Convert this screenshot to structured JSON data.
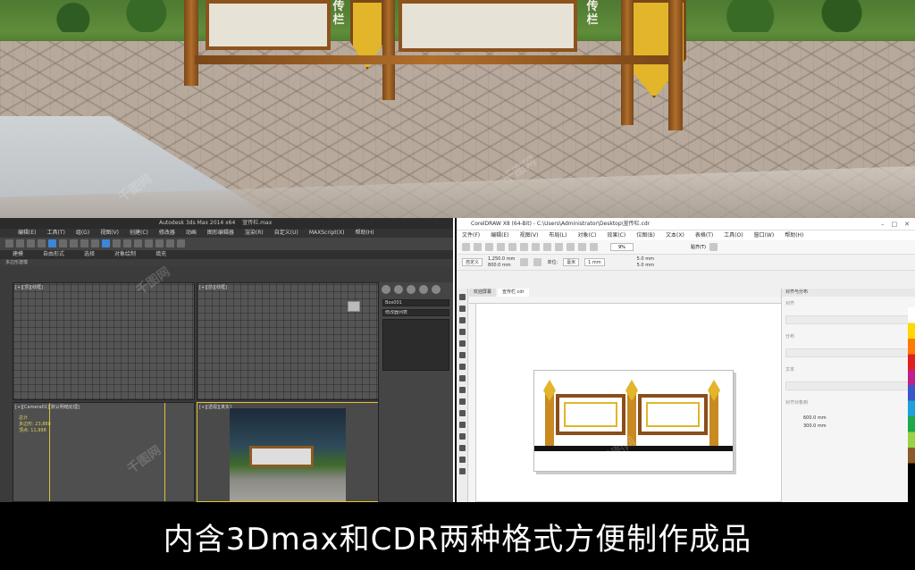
{
  "scene": {
    "panel_labels": [
      "传栏",
      "传栏"
    ]
  },
  "max_window": {
    "title": "Autodesk 3ds Max 2014 x64",
    "file": "宣传栏.max",
    "menus": [
      "编辑(E)",
      "工具(T)",
      "组(G)",
      "视图(V)",
      "创建(C)",
      "修改器",
      "动画",
      "图形编辑器",
      "渲染(R)",
      "自定义(U)",
      "MAXScript(X)",
      "帮助(H)"
    ],
    "ribbon_tabs": [
      "建模",
      "自由形式",
      "选择",
      "对象绘制",
      "填充"
    ],
    "ribbon_sub": "多边形建模",
    "viewports": {
      "top": "[+][顶][线框]",
      "front": "[+][前][线框]",
      "camera": "[+][Camera01][默认明暗处理]",
      "perspective": "[+][透视][真实]",
      "stats": [
        "总计",
        "多边形: 23,888",
        "顶点: 11,998"
      ]
    },
    "command_panel": {
      "object_name": "Box001",
      "modifier_list": "修改器列表"
    }
  },
  "cdr_window": {
    "title": "CorelDRAW X8 (64-Bit) - C:\\Users\\Administrator\\Desktop\\宣传栏.cdr",
    "menus": [
      "文件(F)",
      "编辑(E)",
      "视图(V)",
      "布局(L)",
      "对象(C)",
      "效果(C)",
      "位图(B)",
      "文本(X)",
      "表格(T)",
      "工具(O)",
      "窗口(W)",
      "帮助(H)"
    ],
    "zoom": "9%",
    "snap": "贴齐(T)",
    "page_preset": "自定义",
    "width_value": "1,250.0 mm",
    "height_value": "800.0 mm",
    "unit": "毫米",
    "nudge": "1 mm",
    "grid_x": "5.0 mm",
    "grid_y": "5.0 mm",
    "tabs": [
      "欢迎屏幕",
      "宣传栏.cdr"
    ],
    "docker_title": "对齐与分布",
    "docker_sections": [
      "对齐",
      "分布",
      "文本",
      "对齐对象到"
    ],
    "dims": [
      "600.0 mm",
      "300.0 mm"
    ]
  },
  "caption": "内含3Dmax和CDR两种格式方便制作成品",
  "watermark": "千图网"
}
